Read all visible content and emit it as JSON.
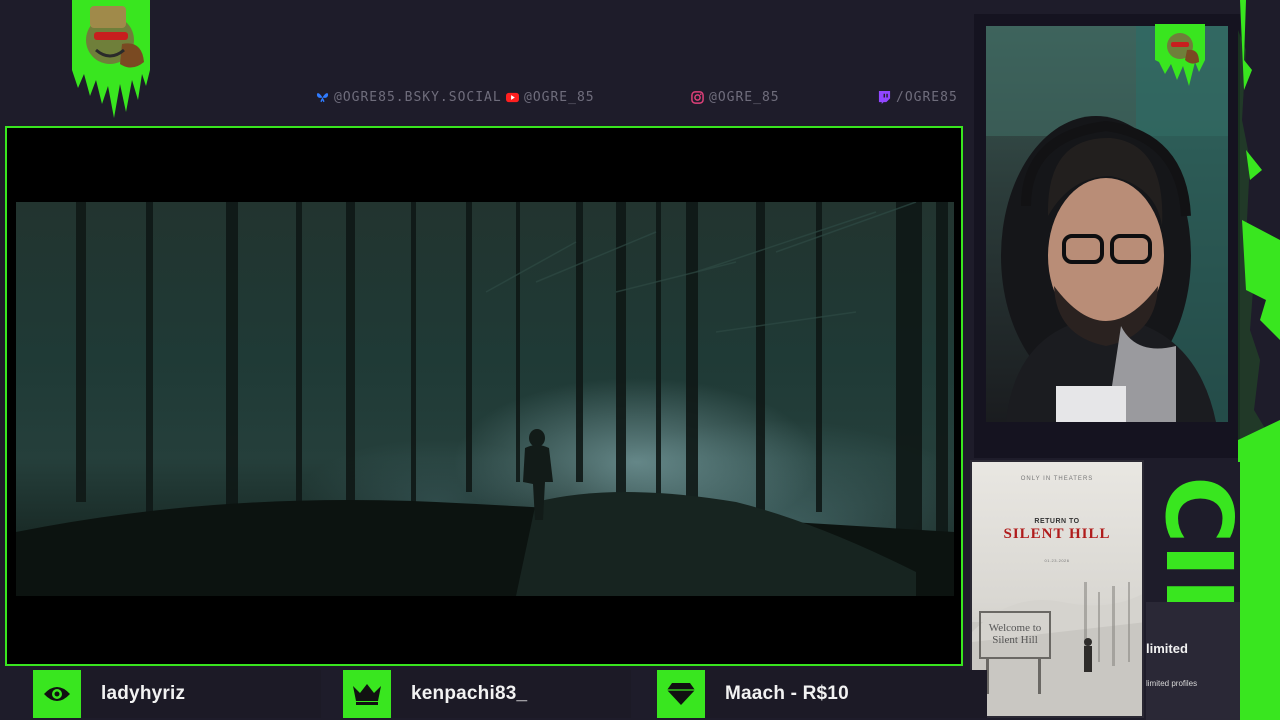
{
  "colors": {
    "accent": "#39e61f",
    "background": "#1e1c2a",
    "muted_text": "#6f6d7c",
    "poster_title": "#b01c1c"
  },
  "socials": [
    {
      "icon": "bluesky-icon",
      "color": "#2f7bff",
      "handle": "@OGRE85.BSKY.SOCIAL"
    },
    {
      "icon": "youtube-icon",
      "color": "#ff1f1f",
      "handle": "@OGRE_85"
    },
    {
      "icon": "instagram-icon",
      "color": "#e0407a",
      "handle": "@OGRE_85"
    },
    {
      "icon": "twitch-icon",
      "color": "#9146ff",
      "handle": "/OGRE85"
    }
  ],
  "poster": {
    "kicker": "ONLY IN THEATERS",
    "small_title": "RETURN TO",
    "big_title": "SILENT HILL",
    "tagline": "01.23.2026",
    "sign_line_1": "Welcome to",
    "sign_line_2": "Silent Hill"
  },
  "cine": {
    "text": "CINE"
  },
  "sponsor": {
    "name": "limited",
    "sub": "limited profiles"
  },
  "events": [
    {
      "icon": "eye-icon",
      "label": "ladyhyriz"
    },
    {
      "icon": "crown-icon",
      "label": "kenpachi83_"
    },
    {
      "icon": "diamond-icon",
      "label": "Maach - R$10"
    }
  ]
}
